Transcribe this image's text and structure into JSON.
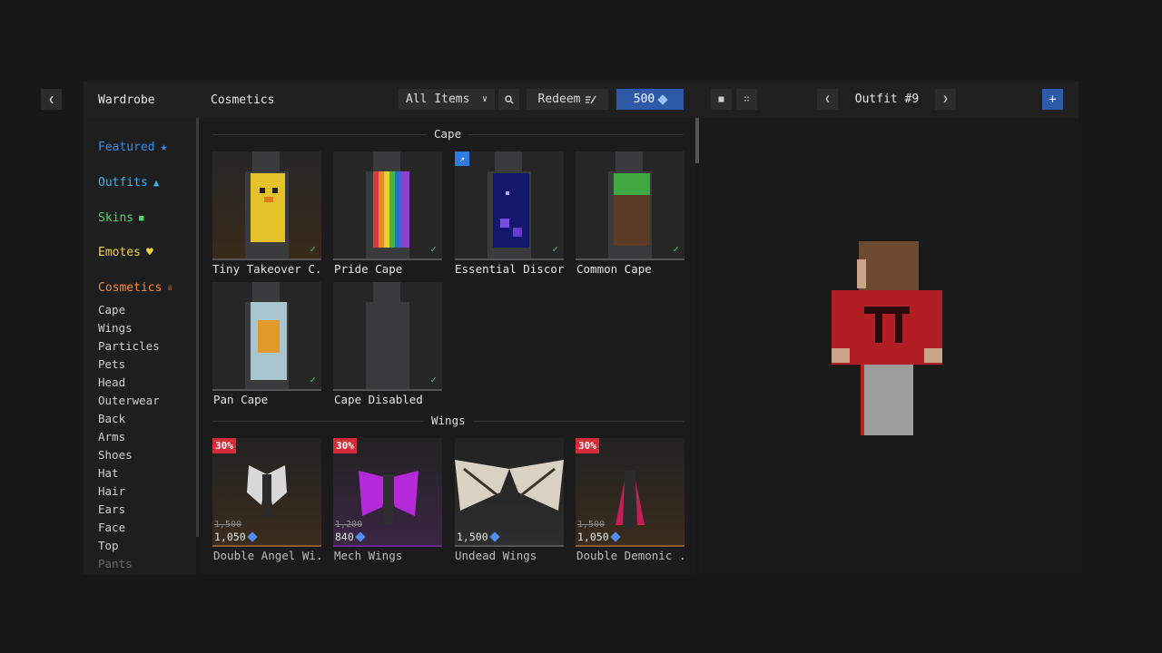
{
  "header": {
    "sidebar_title": "Wardrobe",
    "section_title": "Cosmetics",
    "filter_value": "All Items",
    "redeem_label": "Redeem",
    "coin_balance": "500",
    "outfit_name": "Outfit #9",
    "add_label": "+"
  },
  "sidebar": {
    "categories": [
      {
        "label": "Featured",
        "color": "#3b8cf0",
        "icon": "star-icon"
      },
      {
        "label": "Outfits",
        "color": "#39b6f0",
        "icon": "shirt-icon"
      },
      {
        "label": "Skins",
        "color": "#4fd66a",
        "icon": "person-icon"
      },
      {
        "label": "Emotes",
        "color": "#f3d43a",
        "icon": "heart-icon"
      },
      {
        "label": "Cosmetics",
        "color": "#f08a3a",
        "icon": "crown-icon"
      }
    ],
    "subcategories": [
      "Cape",
      "Wings",
      "Particles",
      "Pets",
      "Head",
      "Outerwear",
      "Back",
      "Arms",
      "Shoes",
      "Hat",
      "Hair",
      "Ears",
      "Face",
      "Top",
      "Pants"
    ]
  },
  "sections": {
    "cape": {
      "title": "Cape",
      "items": [
        {
          "name": "Tiny Takeover C...",
          "owned": true
        },
        {
          "name": "Pride Cape",
          "owned": true
        },
        {
          "name": "Essential Discor...",
          "owned": true
        },
        {
          "name": "Common Cape",
          "owned": true
        },
        {
          "name": "Pan Cape",
          "owned": true
        },
        {
          "name": "Cape Disabled",
          "owned": true
        }
      ]
    },
    "wings": {
      "title": "Wings",
      "items": [
        {
          "name": "Double Angel Wi...",
          "sale": "30%",
          "old_price": "1,500",
          "price": "1,050"
        },
        {
          "name": "Mech Wings",
          "sale": "30%",
          "old_price": "1,200",
          "price": "840"
        },
        {
          "name": "Undead Wings",
          "sale": "",
          "old_price": "",
          "price": "1,500"
        },
        {
          "name": "Double Demonic ...",
          "sale": "30%",
          "old_price": "1,500",
          "price": "1,050"
        }
      ]
    }
  },
  "colors": {
    "accent": "#2f5aa8",
    "sale": "#d42c3a",
    "owned_check": "#5fb86a"
  }
}
